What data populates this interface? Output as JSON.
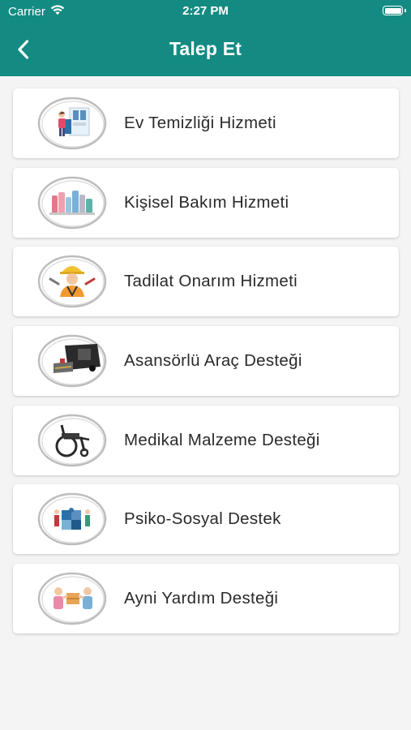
{
  "status_bar": {
    "carrier": "Carrier",
    "time": "2:27 PM",
    "icons": [
      "wifi-icon",
      "battery-icon"
    ]
  },
  "nav": {
    "title": "Talep Et",
    "back_icon": "chevron-left-icon"
  },
  "colors": {
    "header": "#138b82",
    "background": "#f4f4f4",
    "card": "#ffffff",
    "text": "#2a2a2a"
  },
  "services": [
    {
      "label": "Ev Temizliği Hizmeti",
      "icon": "house-cleaning-icon"
    },
    {
      "label": "Kişisel Bakım Hizmeti",
      "icon": "personal-care-icon"
    },
    {
      "label": "Tadilat Onarım Hizmeti",
      "icon": "repair-worker-icon"
    },
    {
      "label": "Asansörlü Araç Desteği",
      "icon": "lift-vehicle-icon"
    },
    {
      "label": "Medikal Malzeme Desteği",
      "icon": "wheelchair-icon"
    },
    {
      "label": "Psiko-Sosyal Destek",
      "icon": "puzzle-people-icon"
    },
    {
      "label": "Ayni Yardım Desteği",
      "icon": "aid-package-icon"
    }
  ]
}
